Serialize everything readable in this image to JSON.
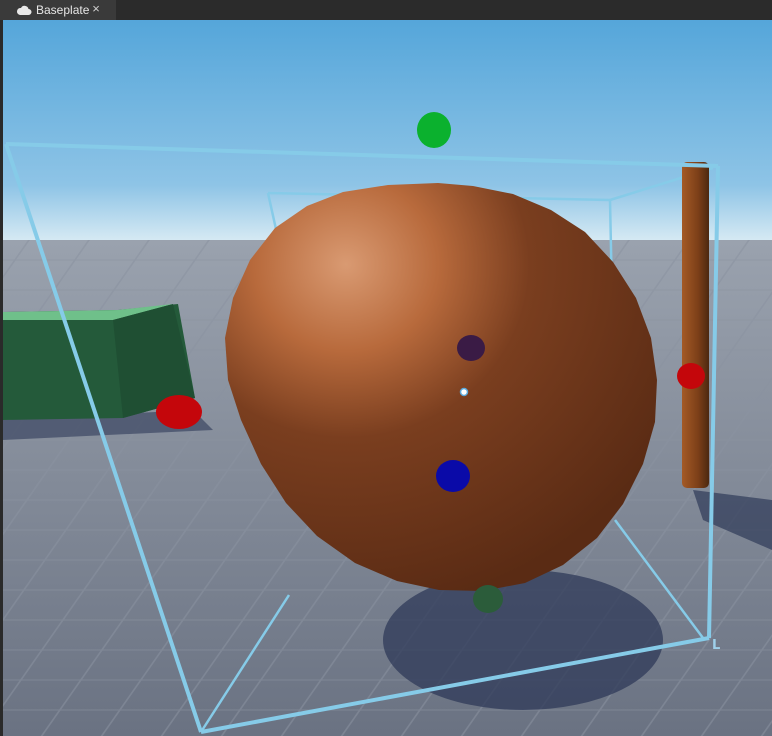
{
  "tab": {
    "title": "Baseplate",
    "close_glyph": "×",
    "icon": "cloud-icon"
  },
  "viewport": {
    "axis_label": "L",
    "colors": {
      "sky_top": "#5aa9dc",
      "sky_horizon": "#cfe6f2",
      "ground": "#7b8494",
      "sphere": "#7a3f1f",
      "selection_box": "#7ec8e8",
      "handle_red": "#c4060b",
      "handle_green": "#0bb12e",
      "handle_blue": "#0a0aa8",
      "green_block": "#2f6e45",
      "pole": "#8a4a1e"
    }
  }
}
